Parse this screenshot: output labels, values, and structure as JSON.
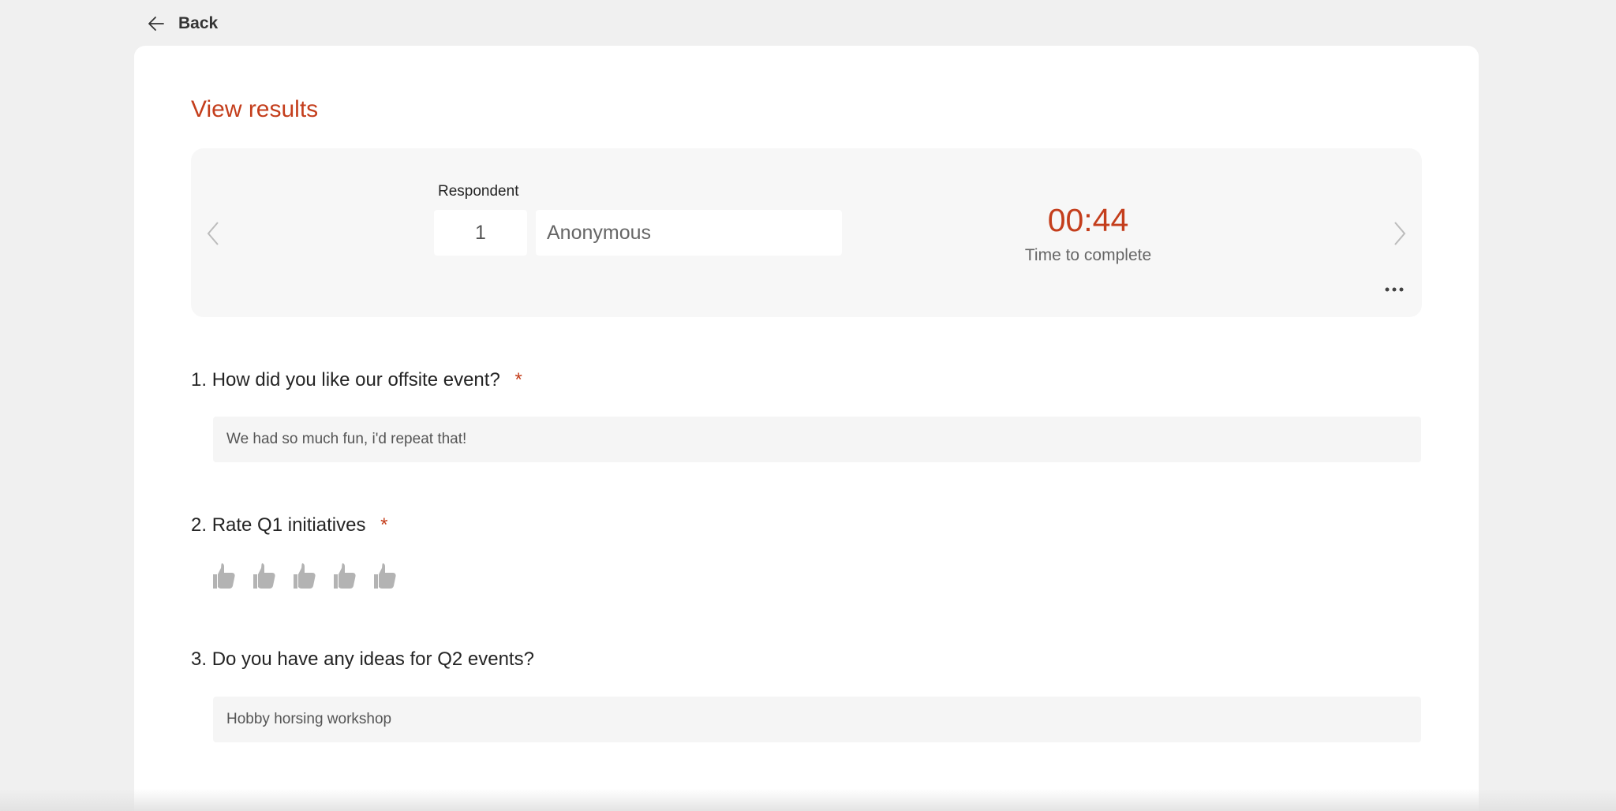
{
  "nav": {
    "back_label": "Back"
  },
  "page": {
    "title": "View results"
  },
  "respondent": {
    "label": "Respondent",
    "number": "1",
    "name": "Anonymous",
    "time_value": "00:44",
    "time_label": "Time to complete"
  },
  "questions": [
    {
      "number": "1.",
      "text": "How did you like our offsite event?",
      "required": true,
      "required_marker": "*",
      "answer": "We had so much fun, i'd repeat that!"
    },
    {
      "number": "2.",
      "text": "Rate Q1 initiatives",
      "required": true,
      "required_marker": "*",
      "rating_selected": 0,
      "rating_max": 5
    },
    {
      "number": "3.",
      "text": "Do you have any ideas for Q2 events?",
      "required": false,
      "answer": "Hobby horsing workshop"
    }
  ],
  "colors": {
    "accent": "#c43e1c",
    "panel": "#f7f7f7",
    "background": "#f0f0f0",
    "thumb_inactive": "#b3b3b3"
  },
  "icons": [
    "arrow-left-icon",
    "chevron-left-icon",
    "chevron-right-icon",
    "more-horizontal-icon",
    "thumb-up-icon"
  ]
}
